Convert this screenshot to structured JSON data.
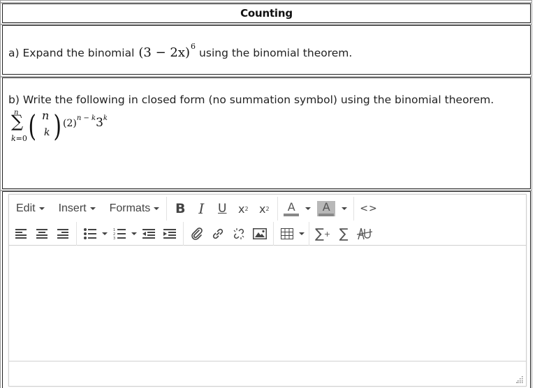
{
  "header": {
    "title": "Counting"
  },
  "question_a": {
    "prefix": "a) Expand the binomial",
    "math": "(3 − 2x)",
    "exponent": "6",
    "suffix": "using the binomial theorem."
  },
  "question_b": {
    "text": "b) Write the following in closed form (no summation symbol) using the binomial theorem.",
    "formula": {
      "sum_upper": "n",
      "sigma": "∑",
      "sum_lower_var": "k",
      "sum_lower_rest": "=0",
      "binom_top": "n",
      "binom_bottom": "k",
      "base1": "(2)",
      "exp1": "n − k",
      "base2": "3",
      "exp2": "k"
    }
  },
  "editor": {
    "menus": [
      {
        "label": "Edit"
      },
      {
        "label": "Insert"
      },
      {
        "label": "Formats"
      }
    ],
    "format_buttons": {
      "bold": "B",
      "italic": "I",
      "underline": "U",
      "subscript": "x",
      "subscript_mark": "2",
      "superscript": "x",
      "superscript_mark": "2"
    },
    "text_color_label": "A",
    "bg_color_label": "A",
    "code_label": "<>",
    "sigma_plus": "∑",
    "sigma_plus_mark": "+",
    "sigma": "∑",
    "content": "",
    "colors": {
      "icon": "#444444",
      "border": "#cfcfcf",
      "bg_highlight": "#b8b8b8"
    }
  }
}
